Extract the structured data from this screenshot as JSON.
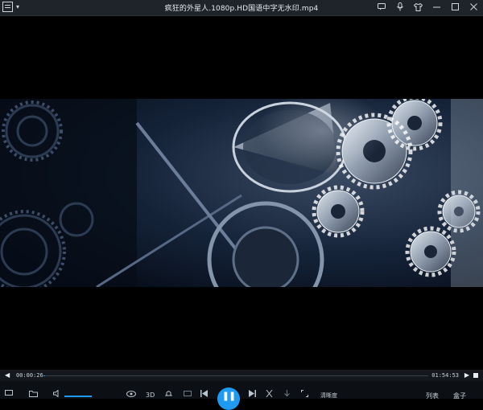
{
  "window": {
    "title": "疯狂的外星人.1080p.HD国语中字无水印.mp4"
  },
  "titlebar_icons": {
    "app_menu": "menu-icon",
    "caret": "caret-down-icon",
    "right": [
      "chat-icon",
      "microphone-icon",
      "shirt-icon",
      "minimize-icon",
      "maximize-icon",
      "close-icon"
    ]
  },
  "playback": {
    "current_time": "00:00:26",
    "total_time": "01:54:53",
    "progress_fraction": 0.004,
    "prev_glyph": "◀",
    "next_glyph": "▶"
  },
  "controls": {
    "play_state": "playing",
    "pause_glyph": "❚❚",
    "label_3d": "3D",
    "label_playlist": "列表",
    "label_box": "盒子",
    "label_quality": "清晰度"
  },
  "colors": {
    "accent": "#1e9bf0",
    "titlebar_bg": "#1f242b"
  }
}
